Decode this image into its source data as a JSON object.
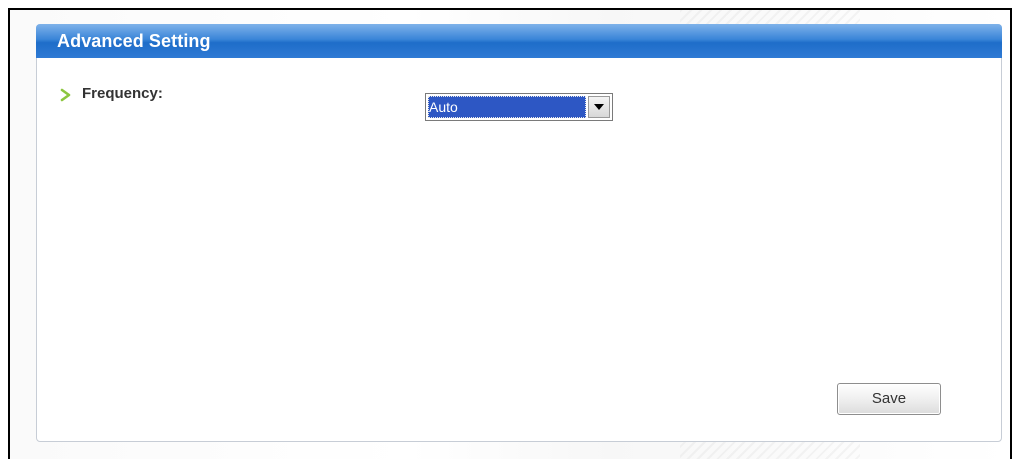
{
  "panel": {
    "title": "Advanced Setting"
  },
  "frequency": {
    "label": "Frequency:",
    "selected_value": "Auto",
    "bullet_icon": "chevron-right-icon",
    "bullet_color": "#8cc63f",
    "dropdown_icon": "chevron-down-icon"
  },
  "actions": {
    "save_label": "Save"
  },
  "colors": {
    "header_blue": "#2f7ad4",
    "selection_blue": "#2d57c4"
  }
}
